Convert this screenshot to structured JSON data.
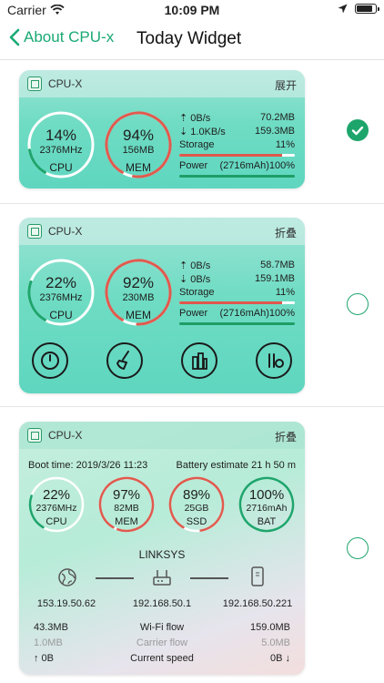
{
  "status": {
    "carrier": "Carrier",
    "time": "10:09 PM",
    "battery_level": 0.92
  },
  "nav": {
    "back_label": "About CPU-x",
    "title": "Today Widget"
  },
  "widgets": [
    {
      "app_name": "CPU-X",
      "toggle_label": "展开",
      "selected": true,
      "cpu": {
        "percent": "14%",
        "freq": "2376MHz",
        "label": "CPU",
        "level": 0.14
      },
      "mem": {
        "percent": "94%",
        "used": "156MB",
        "label": "MEM",
        "level": 0.94
      },
      "upload_rate": "0B/s",
      "upload_total": "70.2MB",
      "download_rate": "1.0KB/s",
      "download_total": "159.3MB",
      "storage_label": "Storage",
      "storage_pct": "11%",
      "storage_level": 0.11,
      "power_label": "Power",
      "power_value": "(2716mAh)100%",
      "power_level": 1.0
    },
    {
      "app_name": "CPU-X",
      "toggle_label": "折叠",
      "selected": false,
      "cpu": {
        "percent": "22%",
        "freq": "2376MHz",
        "label": "CPU",
        "level": 0.22
      },
      "mem": {
        "percent": "92%",
        "used": "230MB",
        "label": "MEM",
        "level": 0.92
      },
      "upload_rate": "0B/s",
      "upload_total": "58.7MB",
      "download_rate": "0B/s",
      "download_total": "159.1MB",
      "storage_label": "Storage",
      "storage_pct": "11%",
      "storage_level": 0.11,
      "power_label": "Power",
      "power_value": "(2716mAh)100%",
      "power_level": 1.0,
      "actions": [
        "speed-icon",
        "clean-brush-icon",
        "apps-icon",
        "scan-icon"
      ]
    },
    {
      "app_name": "CPU-X",
      "toggle_label": "折叠",
      "selected": false,
      "boot_time": "Boot time: 2019/3/26 11:23",
      "battery_estimate": "Battery estimate 21 h 50 m",
      "gauges": [
        {
          "value": "22%",
          "sub": "2376MHz",
          "label": "CPU",
          "level": 0.22,
          "color": "#1ea56c"
        },
        {
          "value": "97%",
          "sub": "82MB",
          "label": "MEM",
          "level": 0.97,
          "color": "#e15a4e"
        },
        {
          "value": "89%",
          "sub": "25GB",
          "label": "SSD",
          "level": 0.89,
          "color": "#e15a4e"
        },
        {
          "value": "100%",
          "sub": "2716mAh",
          "label": "BAT",
          "level": 1.0,
          "color": "#1ea56c"
        }
      ],
      "ssid": "LINKSYS",
      "ips": [
        "153.19.50.62",
        "192.168.50.1",
        "192.168.50.221"
      ],
      "wifi_in": "43.3MB",
      "wifi_label": "Wi-Fi flow",
      "wifi_out": "159.0MB",
      "carrier_in": "1.0MB",
      "carrier_label": "Carrier flow",
      "carrier_out": "5.0MB",
      "speed_up": "↑ 0B",
      "speed_label": "Current speed",
      "speed_down": "0B ↓"
    }
  ],
  "colors": {
    "accent": "#1ea56c",
    "danger": "#e15a4e",
    "power_green": "#1e9e66",
    "storage_red": "#e0574c"
  }
}
